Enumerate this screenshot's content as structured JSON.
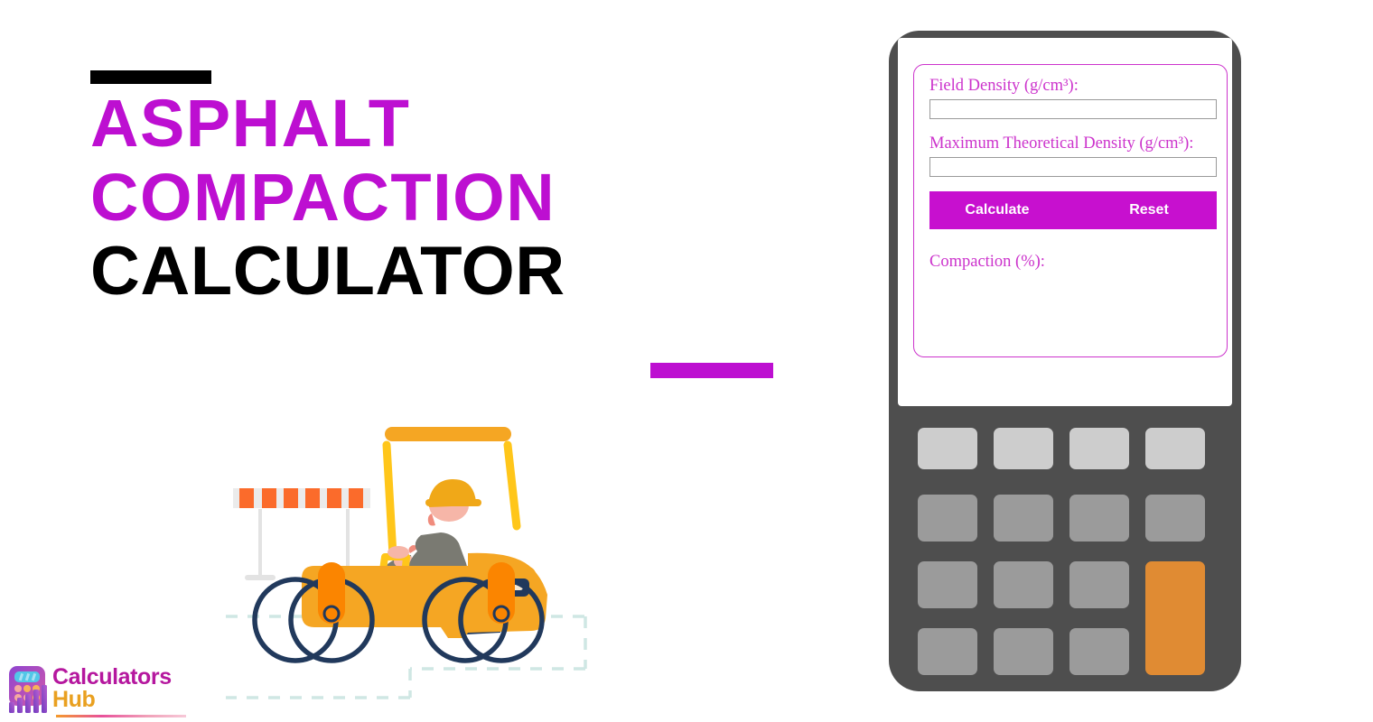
{
  "hero": {
    "title_line1": "Asphalt",
    "title_line2": "Compaction",
    "title_line3": "Calculator",
    "accent_black_color": "#000000",
    "accent_magenta_color": "#bd0fd1",
    "title_magenta_color": "#bd0fd1",
    "title_black_color": "#000000"
  },
  "logo": {
    "line1": "Calculators",
    "line2": "Hub",
    "line1_color": "#b5179e",
    "line2_color": "#e9a020",
    "icon_name": "calculator-bars-logo-icon"
  },
  "illustration": {
    "name": "road-roller-compactor-illustration",
    "body_color": "#f5a623",
    "canopy_color": "#ffc61a",
    "wheel_outline_color": "#21395c",
    "drum_accent_color": "#fb8500",
    "operator_helmet_color": "#f0a818",
    "operator_shirt_color": "#7a7a72",
    "operator_pants_color": "#f97d09",
    "seat_color": "#21395c",
    "barrier_stripe_color": "#fb6b2b",
    "barrier_base_color": "#e8e8e8",
    "road_dash_color": "#cfe7e4"
  },
  "device": {
    "name": "calculator-phone-mockup",
    "frame_color": "#4e4e4e",
    "screen_color": "#ffffff",
    "form": {
      "border_color": "#cc33cc",
      "label_color": "#cc33cc",
      "fields": [
        {
          "label": "Field Density (g/cm³):",
          "value": "",
          "placeholder": ""
        },
        {
          "label": "Maximum Theoretical Density (g/cm³):",
          "value": "",
          "placeholder": ""
        }
      ],
      "buttons": {
        "calculate": "Calculate",
        "reset": "Reset",
        "bar_color": "#c710cf",
        "text_color": "#ffffff"
      },
      "result_label": "Compaction (%):"
    },
    "keypad": {
      "rows": 4,
      "cols": 4,
      "top_row_color": "#cdcdcd",
      "key_color": "#9b9b9b",
      "accent_key_color": "#e08b33",
      "accent_key_span": 2
    }
  }
}
